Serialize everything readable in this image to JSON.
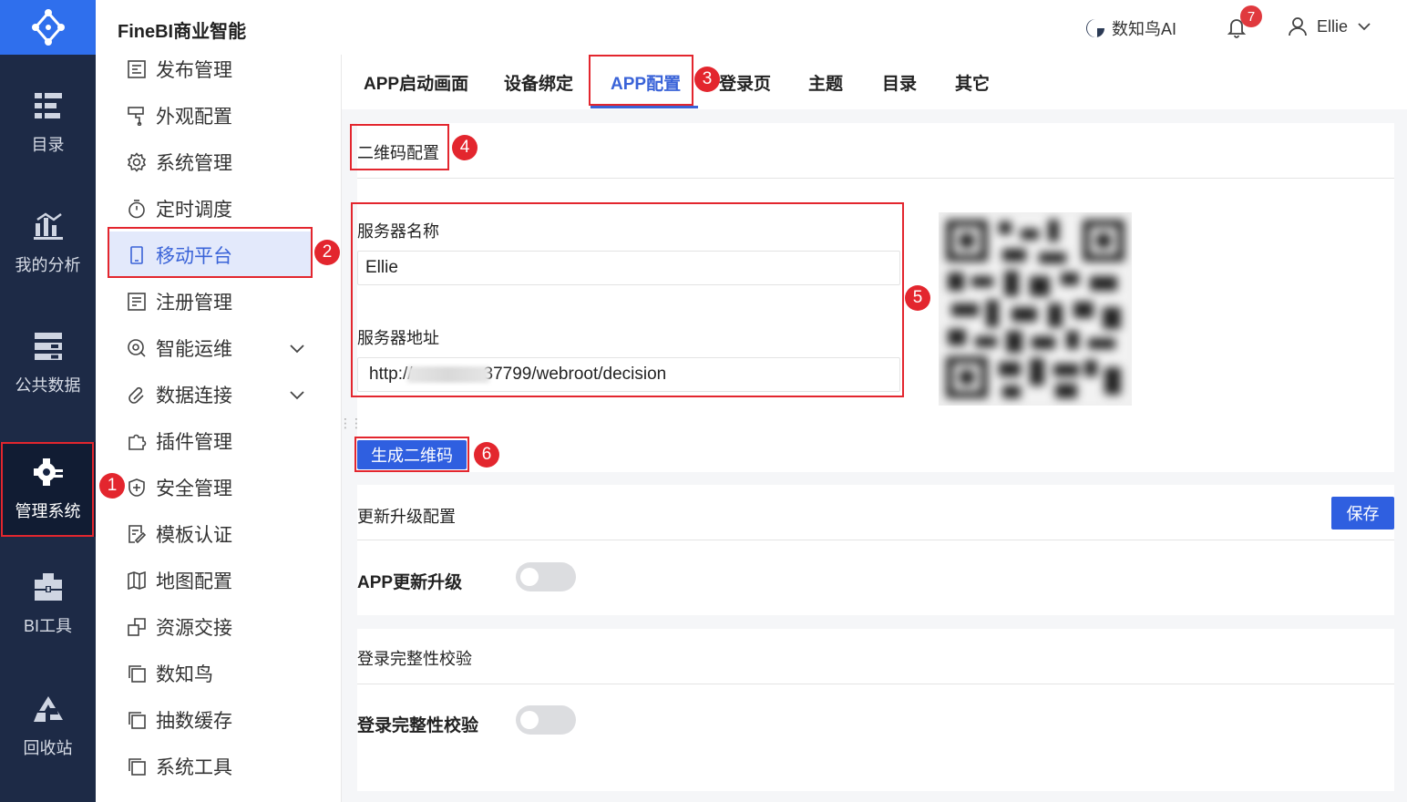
{
  "header": {
    "app_title": "FineBI商业智能",
    "ai_label": "数知鸟AI",
    "notification_count": "7",
    "user_name": "Ellie"
  },
  "rail": {
    "items": [
      {
        "label": "目录",
        "icon": "catalog-icon"
      },
      {
        "label": "我的分析",
        "icon": "analysis-icon"
      },
      {
        "label": "公共数据",
        "icon": "public-data-icon"
      },
      {
        "label": "管理系统",
        "icon": "management-gear-icon",
        "active": true
      },
      {
        "label": "BI工具",
        "icon": "toolbox-icon"
      },
      {
        "label": "回收站",
        "icon": "recycle-icon"
      }
    ]
  },
  "menu": {
    "items": [
      {
        "label": "发布管理",
        "icon": "publish-icon"
      },
      {
        "label": "外观配置",
        "icon": "appearance-icon"
      },
      {
        "label": "系统管理",
        "icon": "gear-icon"
      },
      {
        "label": "定时调度",
        "icon": "timer-icon"
      },
      {
        "label": "移动平台",
        "icon": "mobile-icon",
        "active": true
      },
      {
        "label": "注册管理",
        "icon": "register-icon"
      },
      {
        "label": "智能运维",
        "icon": "ops-icon",
        "expandable": true
      },
      {
        "label": "数据连接",
        "icon": "link-icon",
        "expandable": true
      },
      {
        "label": "插件管理",
        "icon": "plugin-icon"
      },
      {
        "label": "安全管理",
        "icon": "shield-icon"
      },
      {
        "label": "模板认证",
        "icon": "template-auth-icon"
      },
      {
        "label": "地图配置",
        "icon": "map-icon"
      },
      {
        "label": "资源交接",
        "icon": "handover-icon"
      },
      {
        "label": "数知鸟",
        "icon": "copy-icon"
      },
      {
        "label": "抽数缓存",
        "icon": "copy-icon"
      },
      {
        "label": "系统工具",
        "icon": "copy-icon"
      }
    ]
  },
  "tabs": [
    {
      "label": "APP启动画面"
    },
    {
      "label": "设备绑定"
    },
    {
      "label": "APP配置",
      "active": true
    },
    {
      "label": "登录页"
    },
    {
      "label": "主题"
    },
    {
      "label": "目录"
    },
    {
      "label": "其它"
    }
  ],
  "qr_section": {
    "title": "二维码配置",
    "server_name_label": "服务器名称",
    "server_name_value": "Ellie",
    "server_address_label": "服务器地址",
    "server_address_prefix": "http://",
    "server_address_suffix": "37799/webroot/decision",
    "generate_button": "生成二维码"
  },
  "update_section": {
    "title": "更新升级配置",
    "save_button": "保存",
    "toggle_label": "APP更新升级",
    "toggle_on": false
  },
  "login_section": {
    "title": "登录完整性校验",
    "toggle_label": "登录完整性校验",
    "toggle_on": false
  },
  "annotations": [
    "1",
    "2",
    "3",
    "4",
    "5",
    "6"
  ],
  "colors": {
    "accent": "#2f5fe0",
    "rail_bg": "#1d2a46",
    "annotation": "#e3262e"
  }
}
